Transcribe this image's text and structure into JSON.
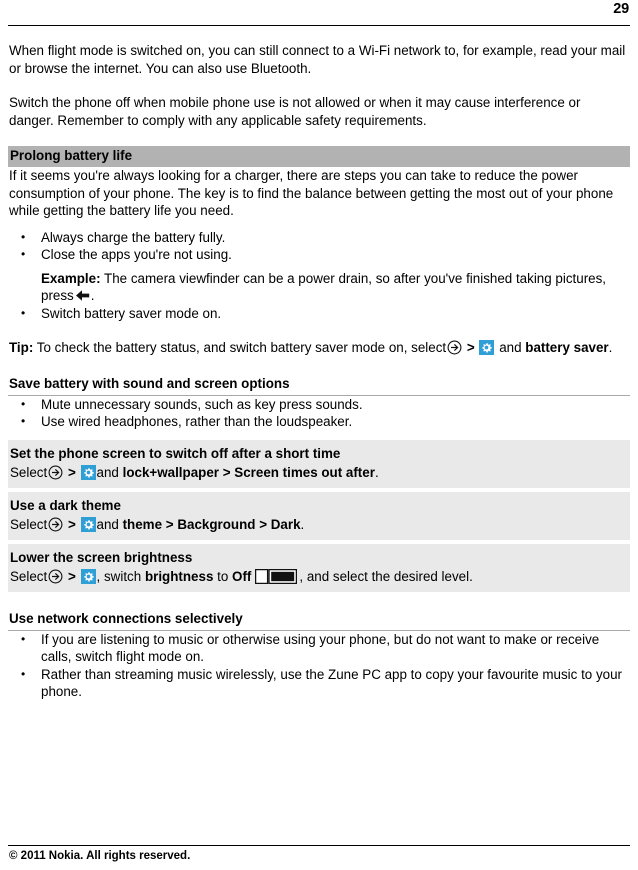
{
  "header": {
    "page_number": "29"
  },
  "intro": {
    "paragraph_1": "When flight mode is switched on, you can still connect to a Wi-Fi network to, for example, read your mail or browse the internet. You can also use Bluetooth.",
    "paragraph_2": "Switch the phone off when mobile phone use is not allowed or when it may cause interference or danger. Remember to comply with any applicable safety requirements."
  },
  "prolong_battery": {
    "heading": "Prolong battery life",
    "intro": "If it seems you're always looking for a charger, there are steps you can take to reduce the power consumption of your phone. The key is to find the balance between getting the most out of your phone while getting the battery life you need.",
    "bullets": [
      "Always charge the battery fully.",
      "Close the apps you're not using.",
      "Switch battery saver mode on."
    ],
    "example_label": "Example:",
    "example_text_before": "The camera viewfinder can be a power drain, so after you've finished taking pictures, press",
    "example_text_after": ".",
    "back_icon": "back-arrow-icon"
  },
  "tip": {
    "label": "Tip:",
    "text_before": "To check the battery status, and switch battery saver mode on, select",
    "separator": ">",
    "text_middle": "and",
    "bold_target": "battery saver",
    "text_after": ".",
    "arrow_icon": "arrow-right-circle-icon",
    "settings_icon": "settings-gear-icon"
  },
  "save_battery": {
    "heading": "Save battery with sound and screen options",
    "bullets": [
      "Mute unnecessary sounds, such as key press sounds.",
      "Use wired headphones, rather than the loudspeaker."
    ]
  },
  "blocks": [
    {
      "title": "Set the phone screen to switch off after a short time",
      "select_label": "Select",
      "sep1": ">",
      "and_label": "and",
      "bold_item": "lock+wallpaper",
      "sep2": ">",
      "bold_item2": "Screen times out after",
      "tail": "."
    },
    {
      "title": "Use a dark theme",
      "select_label": "Select",
      "sep1": ">",
      "and_label": "and",
      "bold_item": "theme",
      "sep2": ">",
      "bold_item2": "Background",
      "sep3": ">",
      "bold_item3": "Dark",
      "tail": "."
    },
    {
      "title": "Lower the screen brightness",
      "select_label": "Select",
      "sep1": ">",
      "comma": ",",
      "switch_label": "switch",
      "bold_item": "brightness",
      "to_label": "to",
      "bold_item2": "Off",
      "tail": ", and select the desired level.",
      "toggle_icon": "toggle-switch-off-icon",
      "toggle_state": "off"
    }
  ],
  "network": {
    "heading": "Use network connections selectively",
    "bullets": [
      "If you are listening to music or otherwise using your phone, but do not want to make or receive calls, switch flight mode on.",
      "Rather than streaming music wirelessly, use the Zune PC app to copy your favourite music to your phone."
    ]
  },
  "footer": {
    "copyright": "© 2011 Nokia. All rights reserved."
  },
  "colors": {
    "accent_blue": "#2f9fd6",
    "heading_bar_gray": "#b2b2b2",
    "block_gray": "#e9e9e9",
    "rule_gray": "#a9a9a9"
  }
}
